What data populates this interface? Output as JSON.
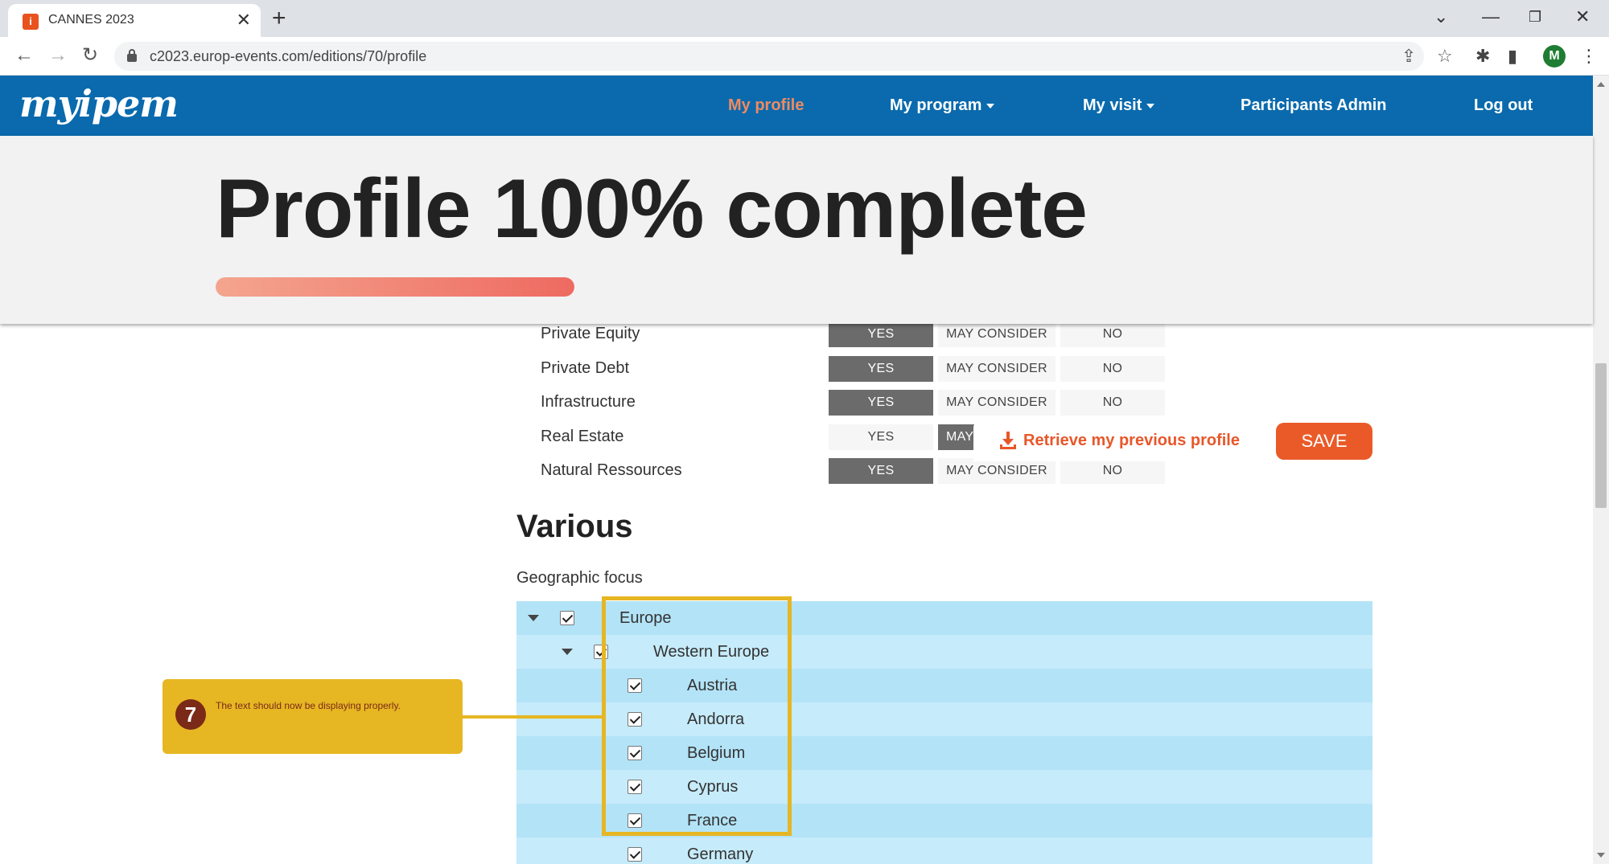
{
  "browser": {
    "tab_title": "CANNES 2023",
    "tab_favicon": "i",
    "url": "c2023.europ-events.com/editions/70/profile",
    "profile_initial": "M"
  },
  "site": {
    "logo": "myipem",
    "nav": {
      "my_profile": "My profile",
      "my_program": "My program",
      "my_visit": "My visit",
      "participants_admin": "Participants Admin",
      "log_out": "Log out"
    },
    "colors": {
      "nav_bg": "#0a6aad",
      "accent": "#ea5a28",
      "active_link": "#f08a62"
    }
  },
  "progress": {
    "title": "Profile 100% complete",
    "percent": 100
  },
  "preferences": {
    "rows": [
      {
        "label": "Private Equity",
        "selected": "yes"
      },
      {
        "label": "Private Debt",
        "selected": "yes"
      },
      {
        "label": "Infrastructure",
        "selected": "yes"
      },
      {
        "label": "Real Estate",
        "selected": "may"
      },
      {
        "label": "Natural Ressources",
        "selected": "yes"
      }
    ],
    "options": {
      "yes": "YES",
      "may": "MAY CONSIDER",
      "no": "NO"
    },
    "partial_may": "MAY"
  },
  "actions": {
    "retrieve": "Retrieve my previous profile",
    "save": "SAVE"
  },
  "various": {
    "title": "Various",
    "geo_label": "Geographic focus",
    "tree": [
      {
        "label": "Europe",
        "level": 0
      },
      {
        "label": "Western Europe",
        "level": 1
      },
      {
        "label": "Austria",
        "level": 2
      },
      {
        "label": "Andorra",
        "level": 2
      },
      {
        "label": "Belgium",
        "level": 2
      },
      {
        "label": "Cyprus",
        "level": 2
      },
      {
        "label": "France",
        "level": 2
      },
      {
        "label": "Germany",
        "level": 2
      }
    ]
  },
  "annotation": {
    "step": "7",
    "text": "The text should now be displaying properly."
  }
}
